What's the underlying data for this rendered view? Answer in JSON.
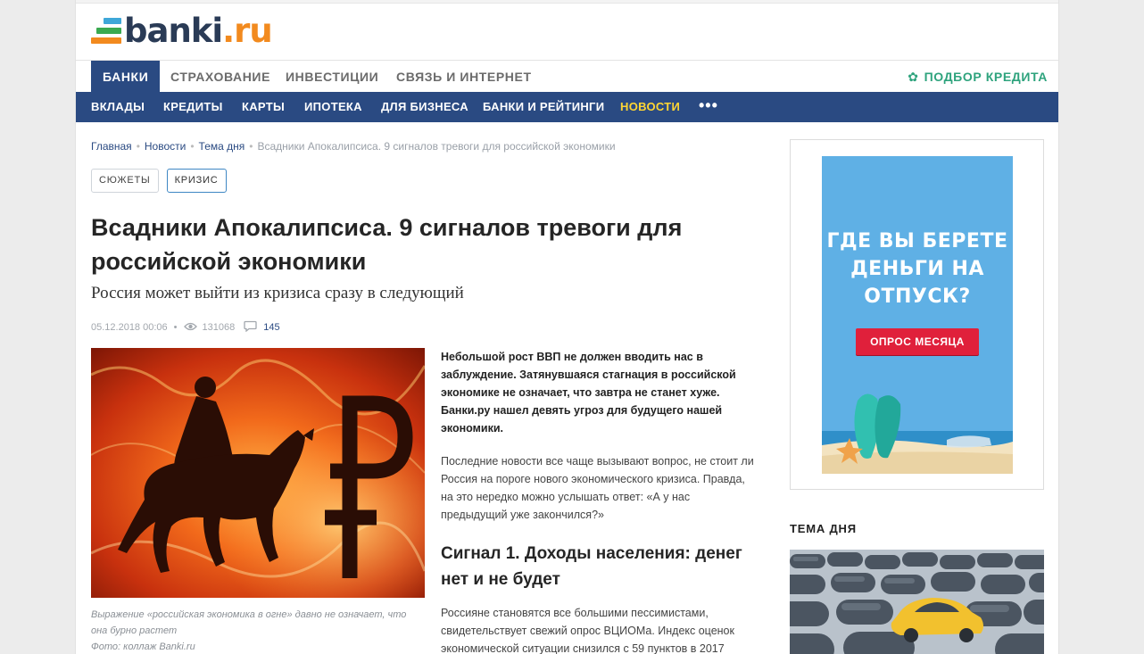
{
  "site": {
    "logo_text": "banki",
    "logo_tld": ".ru"
  },
  "nav_primary": {
    "items": [
      "БАНКИ",
      "СТРАХОВАНИЕ",
      "ИНВЕСТИЦИИ",
      "СВЯЗЬ И ИНТЕРНЕТ"
    ],
    "active": "БАНКИ",
    "credit_link": "ПОДБОР КРЕДИТА",
    "credit_icon": "gear-icon"
  },
  "nav_secondary": {
    "items": [
      "ВКЛАДЫ",
      "КРЕДИТЫ",
      "КАРТЫ",
      "ИПОТЕКА",
      "ДЛЯ БИЗНЕСА",
      "БАНКИ И РЕЙТИНГИ",
      "НОВОСТИ"
    ],
    "highlighted": "НОВОСТИ",
    "more": "•••"
  },
  "breadcrumbs": [
    "Главная",
    "Новости",
    "Тема дня",
    "Всадники Апокалипсиса. 9 сигналов тревоги для российской экономики"
  ],
  "tags": [
    "СЮЖЕТЫ",
    "КРИЗИС"
  ],
  "article": {
    "title": "Всадники Апокалипсиса. 9 сигналов тревоги для российской экономики",
    "subtitle": "Россия может выйти из кризиса сразу в следующий",
    "date": "05.12.2018 00:06",
    "views": "131068",
    "comments": "145",
    "image_caption": "Выражение «российская экономика в огне» давно не означает, что она бурно растет",
    "image_credit": "Фото: коллаж Banki.ru",
    "lead": "Небольшой рост ВВП не должен вводить нас в заблуждение. Затянувшаяся стагнация в российской экономике не означает, что завтра не станет хуже. Банки.ру нашел девять угроз для будущего нашей экономики.",
    "paragraph1": "Последние новости все чаще вызывают вопрос, не стоит ли Россия на пороге нового экономического кризиса. Правда, на это нередко можно услышать ответ: «А у нас предыдущий уже закончился?»",
    "heading1": "Сигнал 1. Доходы населения: денег нет и не будет",
    "paragraph2": "Россияне становятся все большими пессимистами, свидетельствует свежий опрос ВЦИОМа. Индекс оценок экономической ситуации снизился с 59 пунктов в 2017"
  },
  "sidebar": {
    "ad_text": "ГДЕ ВЫ БЕРЕТЕ ДЕНЬГИ НА ОТПУСК?",
    "ad_button": "ОПРОС МЕСЯЦА",
    "theme_title": "ТЕМА ДНЯ"
  },
  "colors": {
    "brand_blue": "#2a4a82",
    "accent_green": "#2ea37d",
    "highlight_yellow": "#ffd633",
    "ad_red": "#e0203b"
  }
}
